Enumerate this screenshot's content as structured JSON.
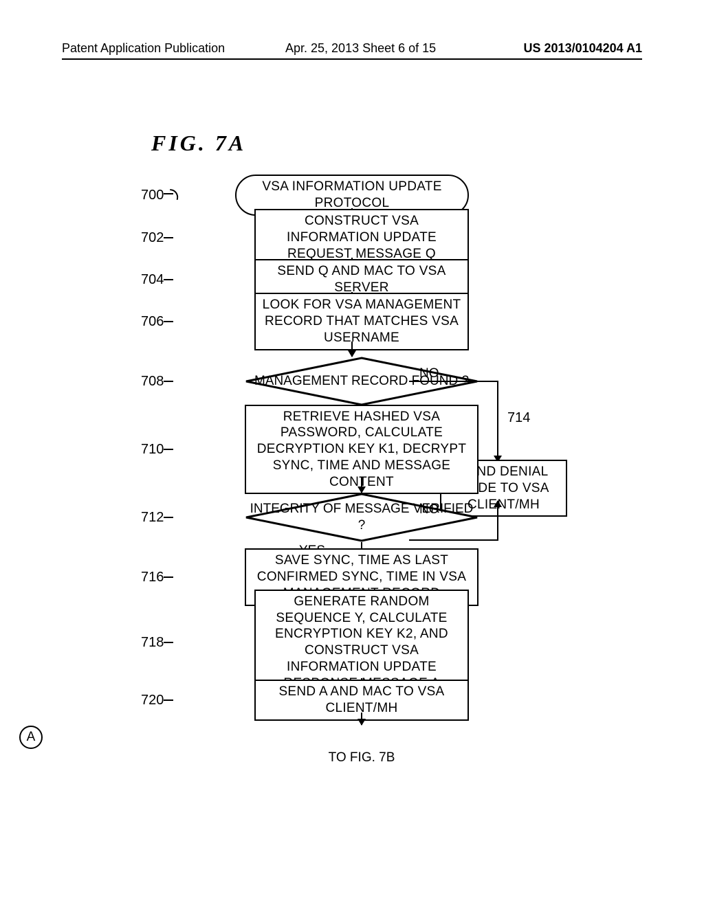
{
  "header": {
    "left": "Patent Application Publication",
    "center": "Apr. 25, 2013  Sheet 6 of 15",
    "right": "US 2013/0104204 A1"
  },
  "figure_title": "FIG.  7A",
  "steps": {
    "s700": {
      "num": "700",
      "text": "VSA INFORMATION UPDATE PROTOCOL"
    },
    "s702": {
      "num": "702",
      "text": "CONSTRUCT VSA INFORMATION UPDATE REQUEST MESSAGE Q"
    },
    "s704": {
      "num": "704",
      "text": "SEND Q AND MAC TO VSA SERVER"
    },
    "s706": {
      "num": "706",
      "text": "LOOK FOR VSA MANAGEMENT RECORD THAT MATCHES VSA USERNAME"
    },
    "s708": {
      "num": "708",
      "text": "MANAGEMENT RECORD FOUND ?"
    },
    "s710": {
      "num": "710",
      "text": "RETRIEVE HASHED VSA PASSWORD, CALCULATE DECRYPTION KEY K1, DECRYPT SYNC, TIME AND MESSAGE CONTENT"
    },
    "s712": {
      "num": "712",
      "text": "INTEGRITY OF MESSAGE VERIFIED ?"
    },
    "s714": {
      "num": "714",
      "text": "SEND DENIAL CODE TO VSA CLIENT/MH"
    },
    "s716": {
      "num": "716",
      "text": "SAVE SYNC, TIME AS LAST CONFIRMED SYNC, TIME IN VSA MANAGEMENT RECORD"
    },
    "s718": {
      "num": "718",
      "text": "GENERATE RANDOM SEQUENCE Y, CALCULATE ENCRYPTION KEY K2, AND CONSTRUCT VSA INFORMATION UPDATE RESPONSE MESSAGE A"
    },
    "s720": {
      "num": "720",
      "text": "SEND A AND MAC TO VSA CLIENT/MH"
    }
  },
  "labels": {
    "yes": "YES",
    "no": "NO"
  },
  "connector": {
    "letter": "A",
    "to": "TO FIG. 7B"
  }
}
